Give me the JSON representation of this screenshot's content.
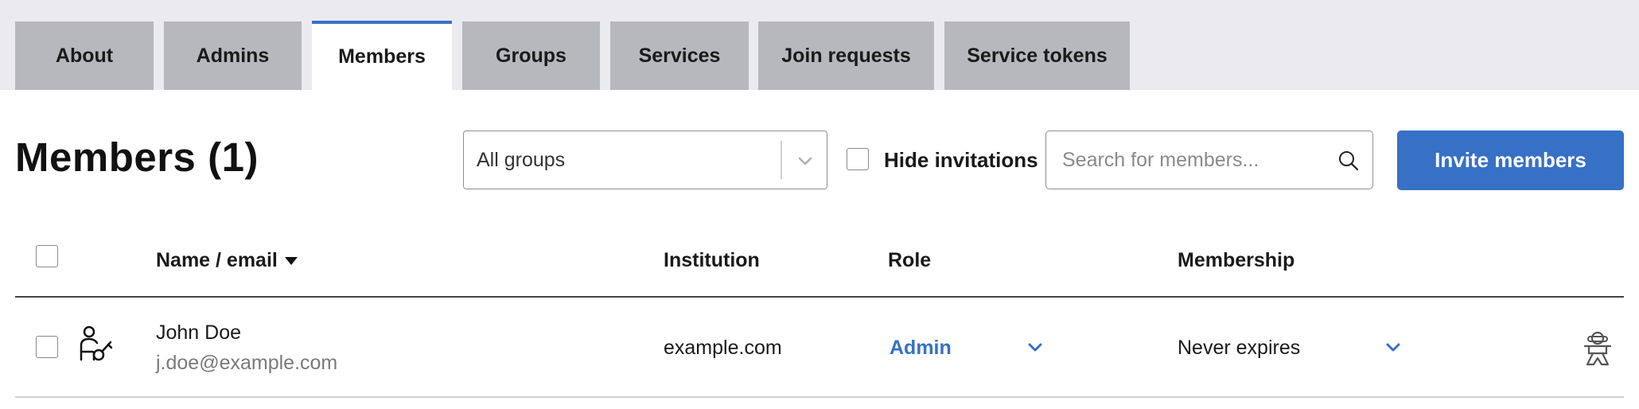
{
  "tabs": [
    {
      "label": "About",
      "active": false
    },
    {
      "label": "Admins",
      "active": false
    },
    {
      "label": "Members",
      "active": true
    },
    {
      "label": "Groups",
      "active": false
    },
    {
      "label": "Services",
      "active": false
    },
    {
      "label": "Join requests",
      "active": false
    },
    {
      "label": "Service tokens",
      "active": false
    }
  ],
  "page": {
    "title": "Members (1)"
  },
  "filters": {
    "group_select": {
      "value": "All groups"
    },
    "hide_invitations_label": "Hide invitations",
    "hide_invitations_checked": false,
    "search": {
      "placeholder": "Search for members...",
      "value": ""
    },
    "invite_label": "Invite members"
  },
  "table": {
    "headers": {
      "name": "Name / email",
      "institution": "Institution",
      "role": "Role",
      "membership": "Membership"
    },
    "sort": {
      "column": "name",
      "direction": "descending"
    },
    "rows": [
      {
        "name": "John Doe",
        "email": "j.doe@example.com",
        "institution": "example.com",
        "role": "Admin",
        "membership": "Never expires",
        "user_icon": "admin-user-icon",
        "action_icon": "impersonate-icon"
      }
    ]
  },
  "colors": {
    "accent": "#3671c6",
    "tab_inactive": "#b6b8bd",
    "tab_bar": "#ebebef"
  }
}
